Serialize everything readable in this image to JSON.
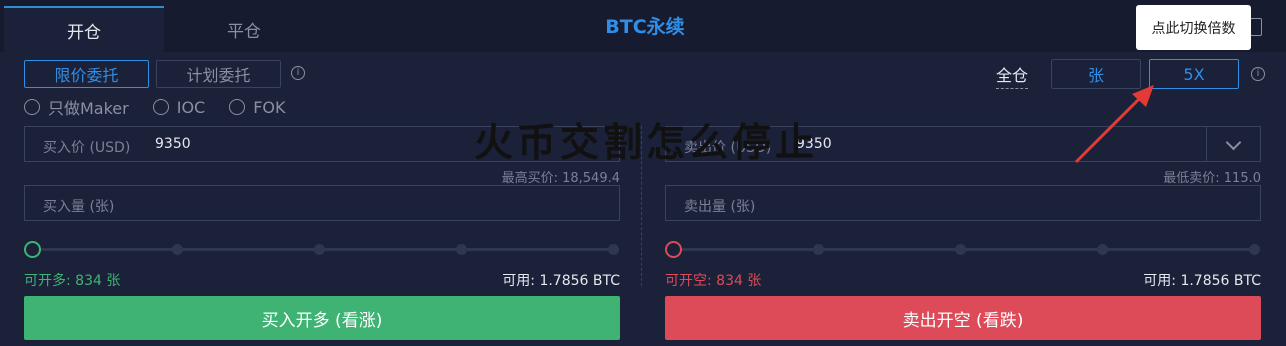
{
  "tabs": [
    {
      "label": "开仓",
      "active": true
    },
    {
      "label": "平仓",
      "active": false
    }
  ],
  "header": {
    "title": "BTC永续"
  },
  "order_types": {
    "limit": "限价委托",
    "plan": "计划委托"
  },
  "radios": [
    {
      "label": "只做Maker"
    },
    {
      "label": "IOC"
    },
    {
      "label": "FOK"
    }
  ],
  "margin": {
    "mode": "全仓",
    "unit": "张",
    "leverage": "5X"
  },
  "tooltip": {
    "text": "点此切换倍数"
  },
  "buy": {
    "price_label": "买入价 (USD)",
    "price_value": "9350",
    "max_price": "最高买价: 18,549.4",
    "qty_placeholder": "买入量 (张)",
    "available_open": "可开多: 834 张",
    "available": "可用: 1.7856 BTC",
    "button": "买入开多 (看涨)",
    "slider_level": 0
  },
  "sell": {
    "price_label": "卖出价 (USD)",
    "price_value": "9350",
    "min_price": "最低卖价: 115.0",
    "qty_placeholder": "卖出量 (张)",
    "available_open": "可开空: 834 张",
    "available": "可用: 1.7856 BTC",
    "button": "卖出开空 (看跌)",
    "slider_level": 0
  },
  "watermark": {
    "text": "火币交割怎么停止"
  },
  "colors": {
    "accent": "#2f8ee8",
    "buy": "#3fb374",
    "sell": "#dd4a58",
    "background": "#1b2138"
  },
  "icons": {
    "info": "info-icon",
    "edit": "edit-icon",
    "dropdown": "chevron-down-icon",
    "radio": "radio-circle-icon"
  }
}
